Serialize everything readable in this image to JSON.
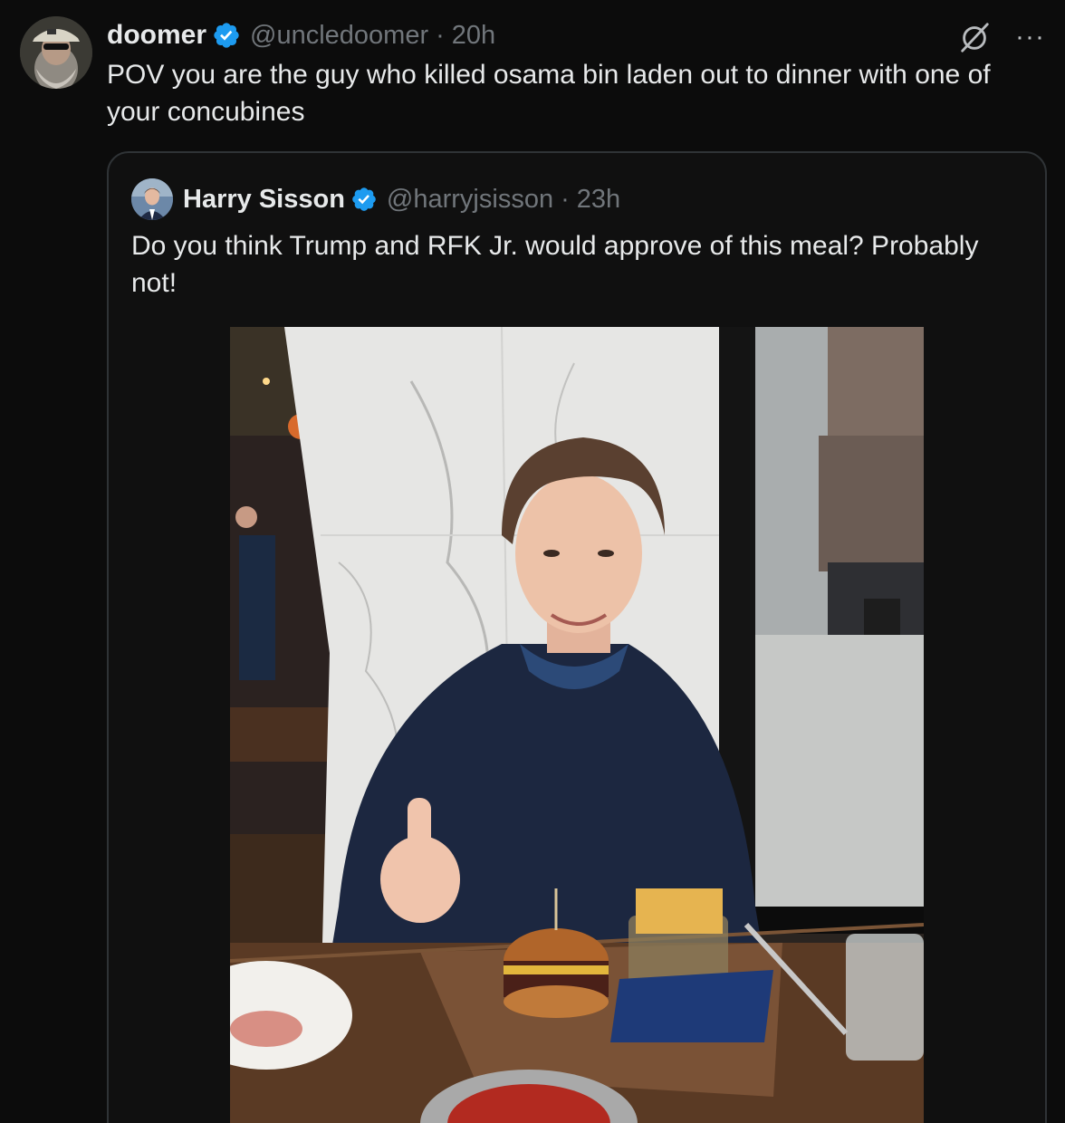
{
  "tweet": {
    "display_name": "doomer",
    "handle": "@uncledoomer",
    "separator": "·",
    "time": "20h",
    "text": "POV you are the guy who killed osama bin laden out to dinner with one of your concubines",
    "more_label": "···",
    "verified_color": "#1d9bf0"
  },
  "quoted": {
    "display_name": "Harry Sisson",
    "handle": "@harryjsisson",
    "separator": "·",
    "time": "23h",
    "text": "Do you think Trump and RFK Jr. would approve of this meal? Probably not!"
  },
  "icons": {
    "verified": "verified-badge-icon",
    "grok": "grok-icon",
    "more": "more-options-icon"
  }
}
